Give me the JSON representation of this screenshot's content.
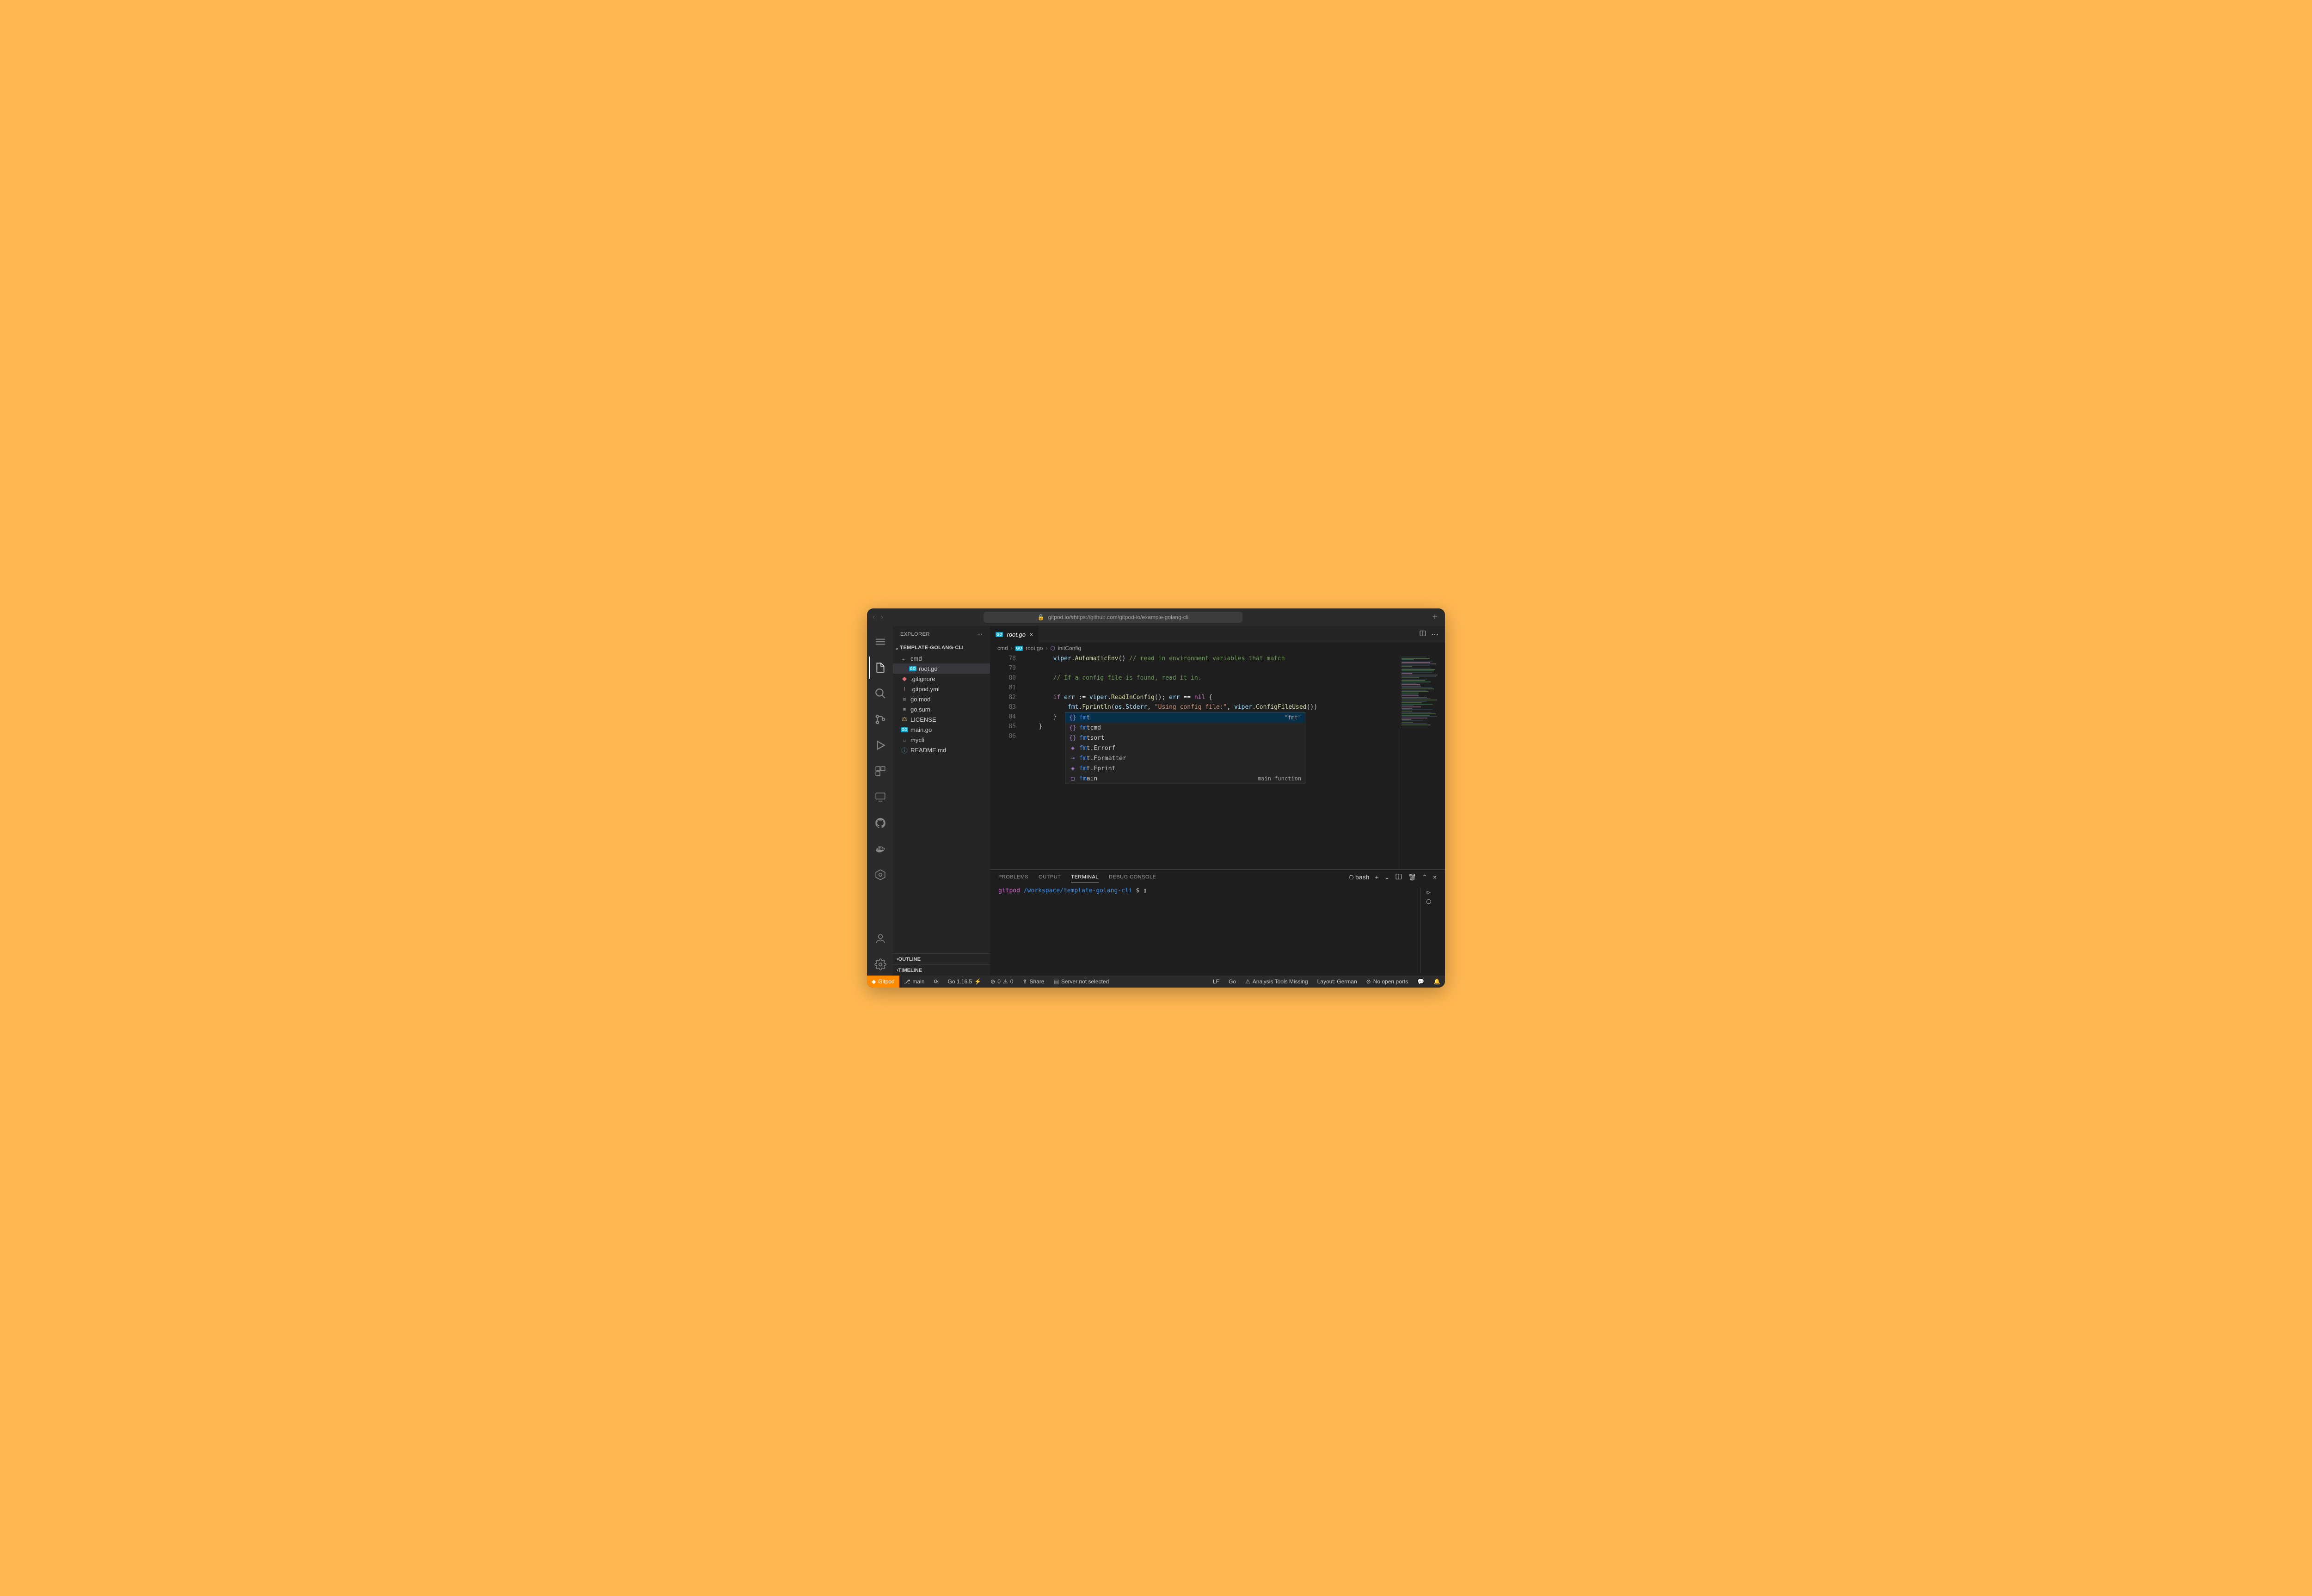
{
  "titlebar": {
    "url": "gitpod.io/#https://github.com/gitpod-io/example-golang-cli"
  },
  "sidebar": {
    "title": "EXPLORER",
    "folder": "TEMPLATE-GOLANG-CLI",
    "tree": [
      {
        "name": "cmd",
        "type": "folder"
      },
      {
        "name": "root.go",
        "type": "go",
        "nested": true,
        "selected": true
      },
      {
        "name": ".gitignore",
        "type": "gitignore"
      },
      {
        "name": ".gitpod.yml",
        "type": "yml"
      },
      {
        "name": "go.mod",
        "type": "file"
      },
      {
        "name": "go.sum",
        "type": "file"
      },
      {
        "name": "LICENSE",
        "type": "license"
      },
      {
        "name": "main.go",
        "type": "go"
      },
      {
        "name": "mycli",
        "type": "file"
      },
      {
        "name": "README.md",
        "type": "info"
      }
    ],
    "sections": [
      "OUTLINE",
      "TIMELINE"
    ]
  },
  "tab": {
    "label": "root.go"
  },
  "breadcrumb": {
    "parts": [
      "cmd",
      "root.go",
      "initConfig"
    ]
  },
  "editor": {
    "startLine": 78,
    "lines": [
      {
        "n": 78,
        "html": "        <span class='id'>viper</span>.<span class='fn'>AutomaticEnv</span>() <span class='com'>// read in environment variables that match</span>"
      },
      {
        "n": 79,
        "html": ""
      },
      {
        "n": 80,
        "html": "        <span class='com'>// If a config file is found, read it in.</span>"
      },
      {
        "n": 81,
        "html": ""
      },
      {
        "n": 82,
        "html": "        <span class='kw'>if</span> <span class='id'>err</span> := <span class='id'>viper</span>.<span class='fn'>ReadInConfig</span>(); <span class='id'>err</span> == <span class='kw'>nil</span> {"
      },
      {
        "n": 83,
        "html": "            <span class='id'>fmt</span>.<span class='fn'>Fprintln</span>(<span class='id'>os</span>.<span class='id'>Stderr</span>, <span class='str'>\"Using config file:\"</span>, <span class='id'>viper</span>.<span class='fn'>ConfigFileUsed</span>())"
      },
      {
        "n": 84,
        "html": "        }"
      },
      {
        "n": 85,
        "html": "    }"
      },
      {
        "n": 86,
        "html": ""
      }
    ]
  },
  "suggest": {
    "items": [
      {
        "icon": "{}",
        "match": "fm",
        "rest": "t",
        "hint": "\"fmt\"",
        "sel": true
      },
      {
        "icon": "{}",
        "match": "fm",
        "rest": "tcmd"
      },
      {
        "icon": "{}",
        "match": "fm",
        "rest": "tsort"
      },
      {
        "icon": "◈",
        "match": "fm",
        "rest": "t.Errorf"
      },
      {
        "icon": "⊸",
        "match": "fm",
        "rest": "t.Formatter"
      },
      {
        "icon": "◈",
        "match": "fm",
        "rest": "t.Fprint"
      },
      {
        "icon": "▢",
        "match": "fm",
        "rest": "ain",
        "hint": "main function"
      }
    ]
  },
  "panel": {
    "tabs": [
      "PROBLEMS",
      "OUTPUT",
      "TERMINAL",
      "DEBUG CONSOLE"
    ],
    "active": "TERMINAL",
    "shell": "bash",
    "prompt_user": "gitpod",
    "prompt_path": "/workspace/template-golang-cli",
    "prompt_sym": "$"
  },
  "status": {
    "gitpod": "Gitpod",
    "branch": "main",
    "go": "Go 1.16.5",
    "errors": "0",
    "warnings": "0",
    "share": "Share",
    "server": "Server not selected",
    "encoding": "LF",
    "lang": "Go",
    "analysis": "Analysis Tools Missing",
    "layout": "Layout: German",
    "ports": "No open ports"
  }
}
